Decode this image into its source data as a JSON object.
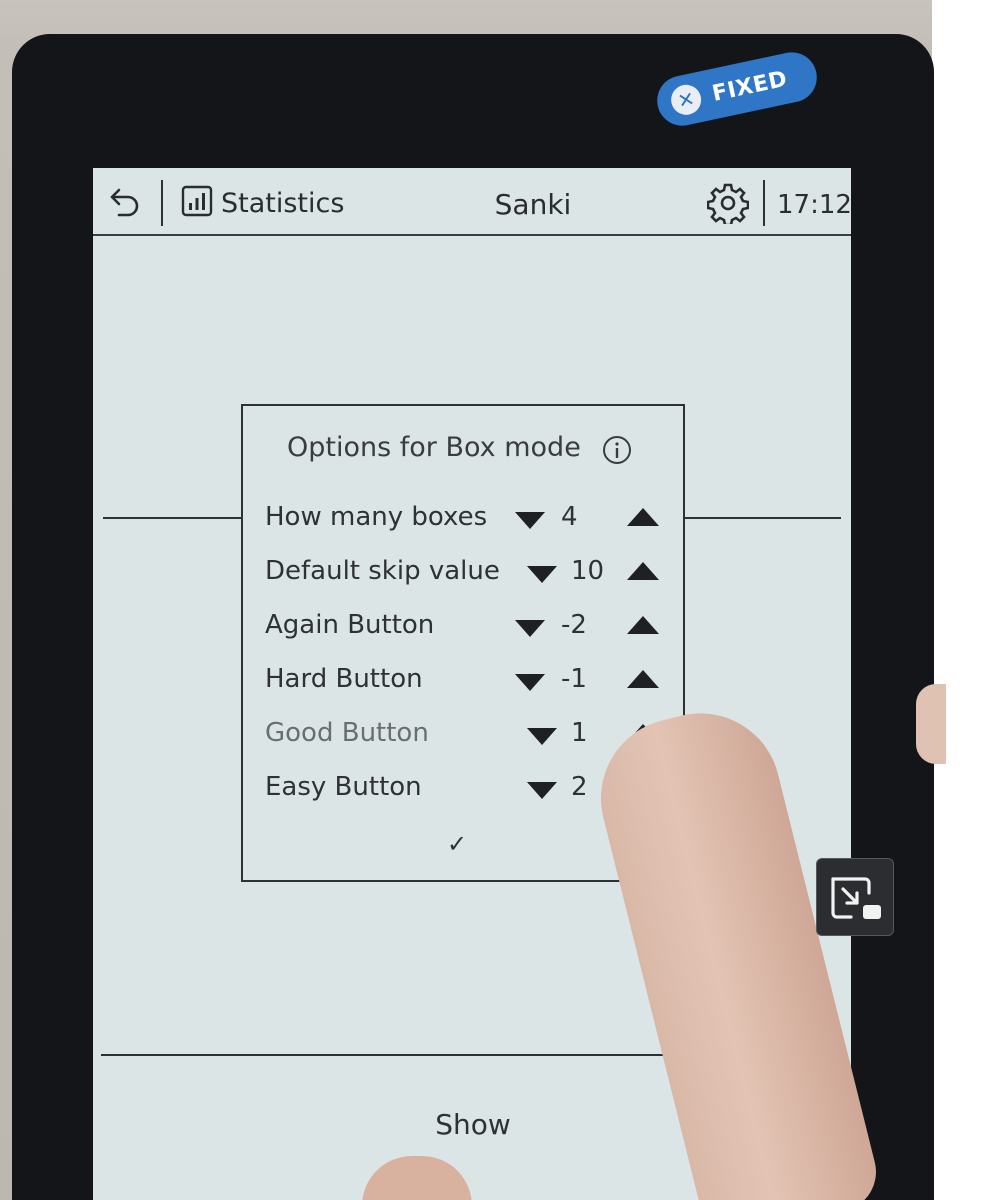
{
  "topbar": {
    "back_icon": "undo-arrow-icon",
    "statistics_label": "Statistics",
    "statistics_icon": "bar-chart-icon",
    "app_title": "Sanki",
    "settings_icon": "gear-icon",
    "clock": "17:12"
  },
  "dialog": {
    "title": "Options for Box mode",
    "info_icon": "info-icon",
    "options": [
      {
        "label": "How many boxes",
        "value": "4"
      },
      {
        "label": "Default skip value",
        "value": "10"
      },
      {
        "label": "Again Button",
        "value": "-2"
      },
      {
        "label": "Hard Button",
        "value": "-1"
      },
      {
        "label": "Good Button",
        "value": "1"
      },
      {
        "label": "Easy Button",
        "value": "2"
      }
    ],
    "confirm": "✓"
  },
  "bottom": {
    "show_label": "Show"
  },
  "overlay": {
    "fixed_badge": "FIXED",
    "exit_pip_icon": "exit-picture-in-picture-icon"
  },
  "colors": {
    "screen_bg": "#dce5e6",
    "badge_blue": "#2f76c6",
    "bezel": "#141518"
  }
}
